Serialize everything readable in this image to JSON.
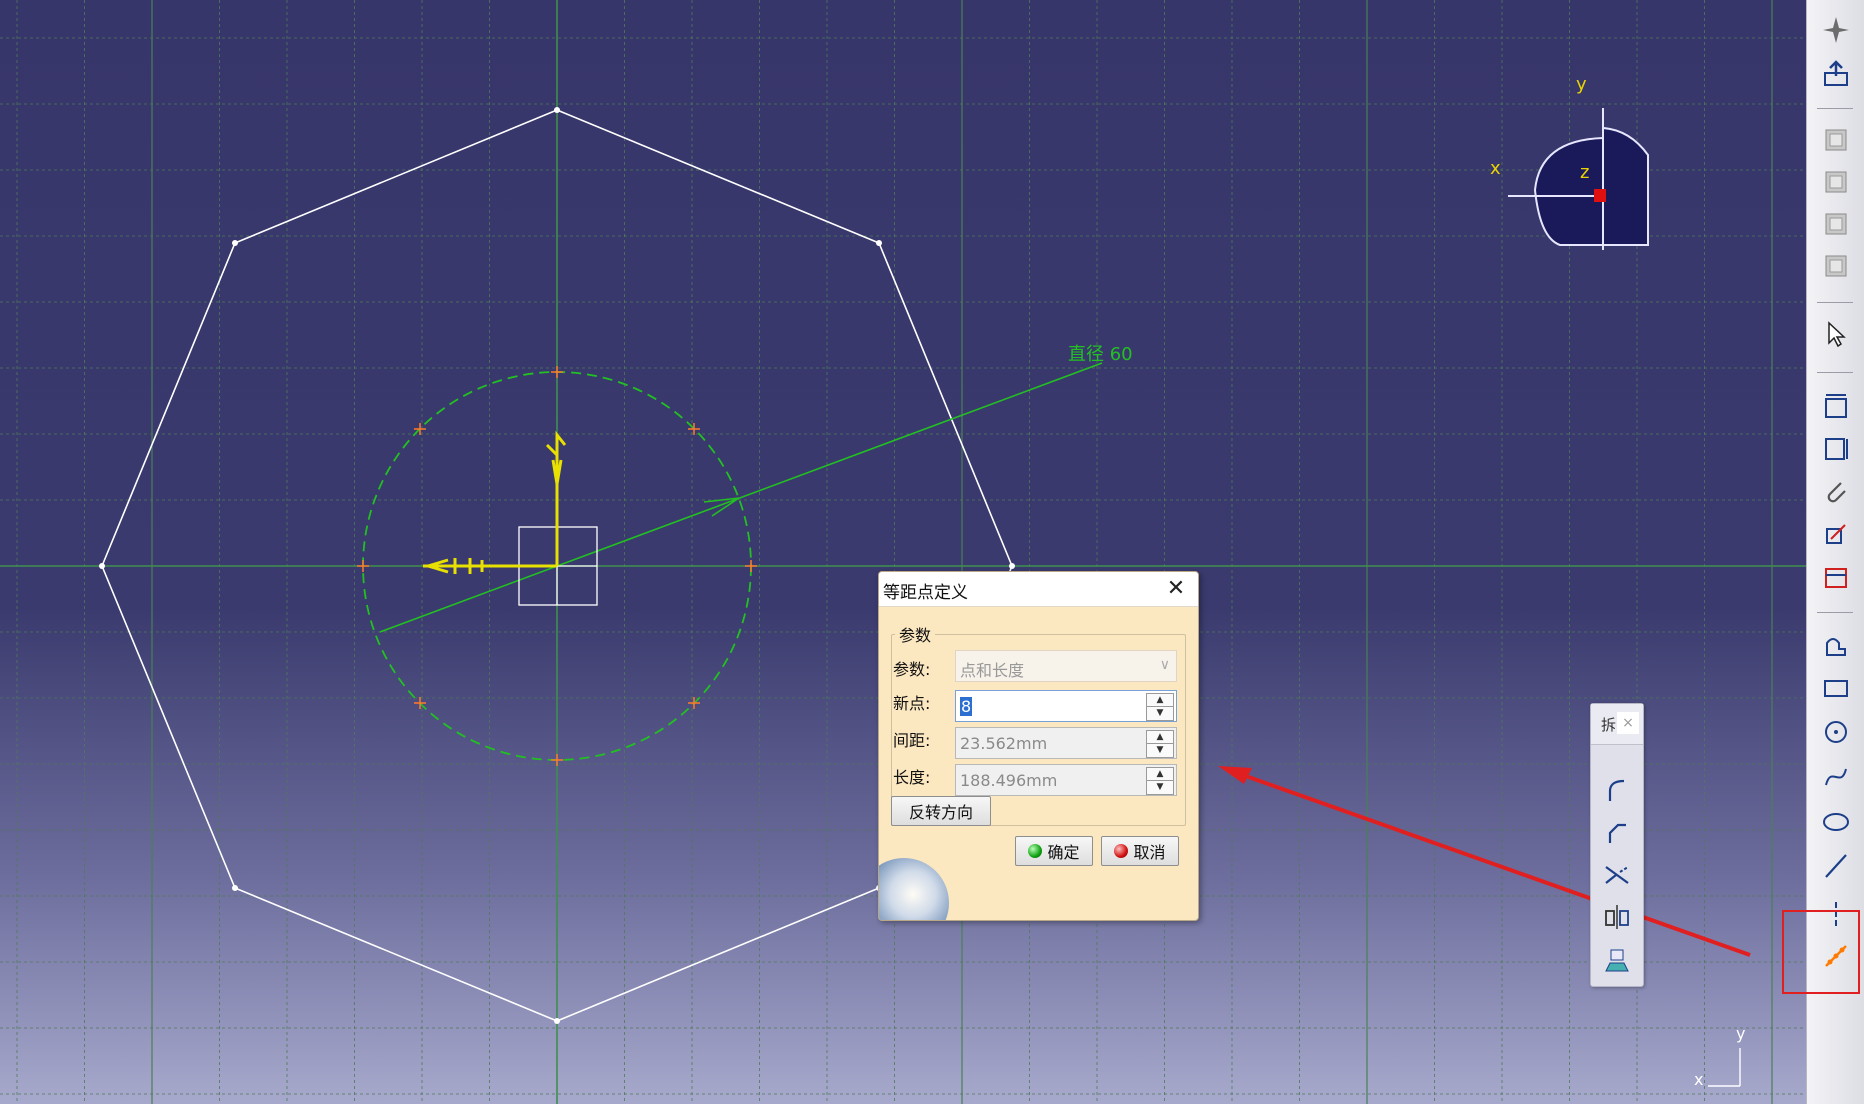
{
  "viewport": {
    "dimension_label": "直径 60",
    "compass": {
      "x_label": "x",
      "y_label": "y",
      "z_label": "z"
    },
    "corner_axes": {
      "x_label": "x",
      "y_label": "y"
    }
  },
  "dialog": {
    "title": "等距点定义",
    "group_label": "参数",
    "param_label": "参数:",
    "param_value": "点和长度",
    "new_point_label": "新点:",
    "new_point_value": "8",
    "spacing_label": "间距:",
    "spacing_value": "23.562mm",
    "length_label": "长度:",
    "length_value": "188.496mm",
    "reverse_button": "反转方向",
    "ok_button": "确定",
    "cancel_button": "取消"
  },
  "floating_toolbar": {
    "title": "拆",
    "close": "×",
    "tools": [
      "corner-icon",
      "chamfer-icon",
      "trim-icon",
      "symmetry-icon",
      "project-3d-icon"
    ]
  },
  "right_toolbar": {
    "tools": [
      "compass-icon",
      "export-icon",
      "view-icon-1",
      "view-icon-2",
      "view-icon-3",
      "view-icon-4",
      "select-arrow-icon",
      "constraint-icon",
      "constraint-box-icon",
      "paperclip-icon",
      "dimension-icon",
      "fix-icon",
      "profile-icon",
      "rectangle-icon",
      "circle-icon",
      "spline-icon",
      "ellipse-icon",
      "line-icon",
      "axis-icon",
      "equidistant-points-icon"
    ]
  },
  "colors": {
    "viewport_top": "#37366a",
    "grid": "#4f7a5a",
    "construction": "#22c022",
    "axes_highlight": "#e8e000",
    "annotation_arrow": "#e02020"
  }
}
